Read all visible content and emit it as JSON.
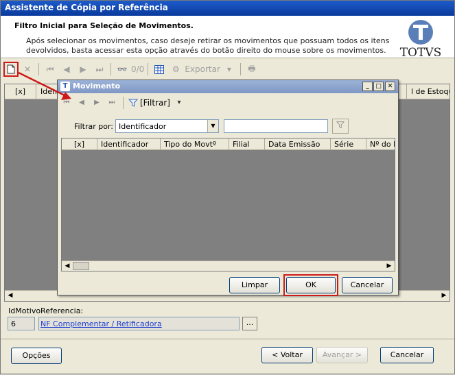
{
  "window": {
    "title": "Assistente de Cópia por Referência"
  },
  "header": {
    "title": "Filtro Inicial para Seleção de Movimentos.",
    "description": "Após selecionar os movimentos, caso deseje retirar os movimentos que possuam todos os itens devolvidos, basta acessar esta opção através do botão direito do mouse sobre os movimentos.",
    "logo_text": "TOTVS"
  },
  "toolbar": {
    "counter": "0/0",
    "export_label": "Exportar",
    "icons": [
      "new-icon",
      "delete-icon",
      "first-icon",
      "prev-icon",
      "next-icon",
      "last-icon",
      "binoculars-icon",
      "grid-icon",
      "export-icon",
      "print-icon"
    ]
  },
  "main_grid": {
    "columns": [
      "[x]",
      "Identi",
      "l de Estoque"
    ]
  },
  "dialog": {
    "title": "Movimento",
    "filter_button_label": "[Filtrar]",
    "filter_label": "Filtrar por:",
    "filter_field_value": "Identificador",
    "filter_text_value": "",
    "columns": [
      "[x]",
      "Identificador",
      "Tipo do Movtº",
      "Filial",
      "Data Emissão",
      "Série",
      "Nº do M"
    ],
    "buttons": {
      "limpar": "Limpar",
      "ok": "OK",
      "cancelar": "Cancelar"
    }
  },
  "motivo": {
    "label": "IdMotivoReferencia:",
    "id_value": "6",
    "link_text": "NF Complementar / Retificadora",
    "lookup_label": "..."
  },
  "footer": {
    "options_label": "Opções",
    "back_label": "< Voltar",
    "next_label": "Avançar >",
    "cancel_label": "Cancelar"
  },
  "colors": {
    "highlight": "#cc1a1a",
    "title_bar": "#0a3a9c",
    "link": "#1a3bd1"
  }
}
